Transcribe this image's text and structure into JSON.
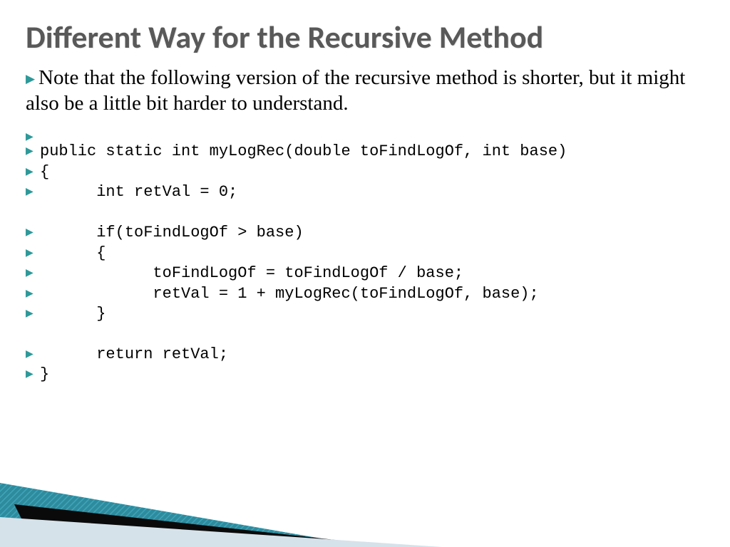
{
  "title": "Different Way for the Recursive Method",
  "intro": "Note that the following version of the recursive method is shorter, but it might also be a little bit harder to understand.",
  "code": {
    "l0": "public static int myLogRec(double toFindLogOf, int base)",
    "l1": "{",
    "l2": "      int retVal = 0;",
    "l3": "      if(toFindLogOf > base)",
    "l4": "      {",
    "l5": "            toFindLogOf = toFindLogOf / base;",
    "l6": "            retVal = 1 + myLogRec(toFindLogOf, base);",
    "l7": "      }",
    "l8": "      return retVal;",
    "l9": "}"
  }
}
